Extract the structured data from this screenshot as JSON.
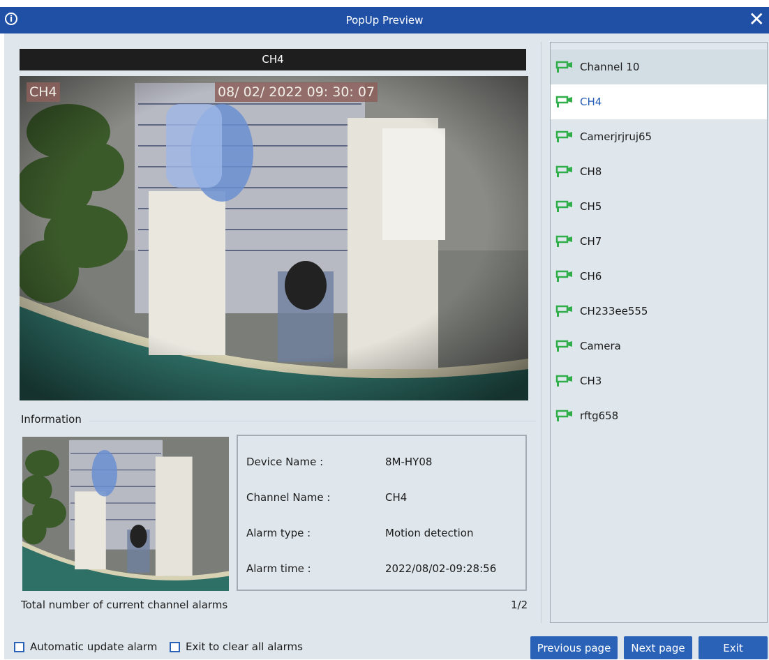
{
  "window": {
    "title": "PopUp Preview",
    "info_icon": "info-icon",
    "close_icon": "close-icon"
  },
  "preview": {
    "channel_title": "CH4",
    "osd_channel": "CH4",
    "osd_timestamp": "08/ 02/ 2022  09: 30: 07"
  },
  "information": {
    "label": "Information",
    "fields": [
      {
        "label": "Device Name :",
        "value": "8M-HY08"
      },
      {
        "label": "Channel Name :",
        "value": "CH4"
      },
      {
        "label": "Alarm type :",
        "value": "Motion detection"
      },
      {
        "label": "Alarm time :",
        "value": "2022/08/02-09:28:56"
      }
    ],
    "total_label": "Total number of current channel alarms",
    "total_count": "1/2"
  },
  "channels": [
    {
      "name": "Channel 10",
      "icon": "camera-icon"
    },
    {
      "name": "CH4",
      "icon": "camera-icon",
      "selected": true
    },
    {
      "name": "Camerjrjruj65",
      "icon": "camera-icon"
    },
    {
      "name": "CH8",
      "icon": "camera-icon"
    },
    {
      "name": "CH5",
      "icon": "camera-icon"
    },
    {
      "name": "CH7",
      "icon": "camera-icon"
    },
    {
      "name": "CH6",
      "icon": "camera-icon"
    },
    {
      "name": "CH233ee555",
      "icon": "camera-icon"
    },
    {
      "name": "Camera",
      "icon": "camera-icon"
    },
    {
      "name": "CH3",
      "icon": "camera-icon"
    },
    {
      "name": "rftg658",
      "icon": "camera-icon"
    }
  ],
  "footer": {
    "auto_update_label": "Automatic update alarm",
    "exit_clear_label": "Exit to clear all alarms",
    "prev_label": "Previous page",
    "next_label": "Next page",
    "exit_label": "Exit"
  },
  "colors": {
    "titlebar": "#1f50a6",
    "accent": "#2a62b8",
    "camera_icon": "#2fae4a",
    "panel": "#dfe7ed"
  }
}
